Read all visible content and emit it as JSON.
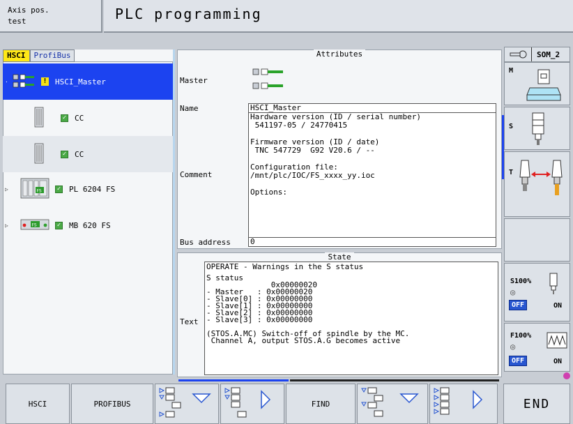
{
  "header": {
    "mode_line1": "Axis pos.",
    "mode_line2": "test",
    "title": "PLC programming"
  },
  "tabs": [
    {
      "label": "HSCI",
      "active": true
    },
    {
      "label": "ProfiBus",
      "active": false
    }
  ],
  "tree": [
    {
      "label": "HSCI_Master",
      "status": "warning",
      "selected": true,
      "expandable": false
    },
    {
      "label": "CC",
      "status": "ok",
      "selected": false,
      "expandable": false
    },
    {
      "label": "CC",
      "status": "ok",
      "selected": false,
      "expandable": false
    },
    {
      "label": "PL 6204 FS",
      "status": "ok",
      "selected": false,
      "expandable": true
    },
    {
      "label": "MB 620 FS",
      "status": "ok",
      "selected": false,
      "expandable": true
    }
  ],
  "attributes": {
    "title": "Attributes",
    "master_label": "Master",
    "name_label": "Name",
    "name_value": "HSCI_Master",
    "comment_label": "Comment",
    "comment_lines": [
      "Hardware version (ID / serial number)",
      " 541197-05 / 24770415",
      "",
      "Firmware version (ID / date)",
      " TNC 547729  G92 V20.6 / --",
      "",
      "Configuration file:",
      "/mnt/plc/IOC/FS_xxxx_yy.ioc",
      "",
      "Options:"
    ],
    "bus_label": "Bus address",
    "bus_value": "0"
  },
  "state": {
    "title": "State",
    "status_line": "OPERATE - Warnings in the S status",
    "text_label": "Text",
    "text_lines": [
      "S status",
      "              0x00000020",
      "- Master   : 0x00000020",
      "- Slave[0] : 0x00000000",
      "- Slave[1] : 0x00000000",
      "- Slave[2] : 0x00000000",
      "- Slave[3] : 0x00000000",
      "",
      "(STOS.A.MC) Switch-off of spindle by the MC.",
      " Channel A, output STOS.A.G becomes active"
    ]
  },
  "right_keys": {
    "top_label": "SOM_2",
    "m_label": "M",
    "s_label": "S",
    "t_label": "T",
    "spindle_override": "S100%",
    "feed_override": "F100%",
    "off_label": "OFF",
    "on_label": "ON"
  },
  "softkeys": [
    {
      "label": "HSCI",
      "icon": ""
    },
    {
      "label": "PROFIBUS",
      "icon": ""
    },
    {
      "label": "",
      "icon": "collapse-tree-icon"
    },
    {
      "label": "",
      "icon": "expand-tree-icon"
    },
    {
      "label": "FIND",
      "icon": ""
    },
    {
      "label": "",
      "icon": "collapse-all-icon"
    },
    {
      "label": "",
      "icon": "expand-all-icon"
    },
    {
      "label": "END",
      "icon": ""
    }
  ],
  "colors": {
    "selected_row": "#1c43f0",
    "tab_active": "#ffe817",
    "ok_check": "#4aa946",
    "warning": "#f6e315",
    "off_button": "#2856d0"
  }
}
